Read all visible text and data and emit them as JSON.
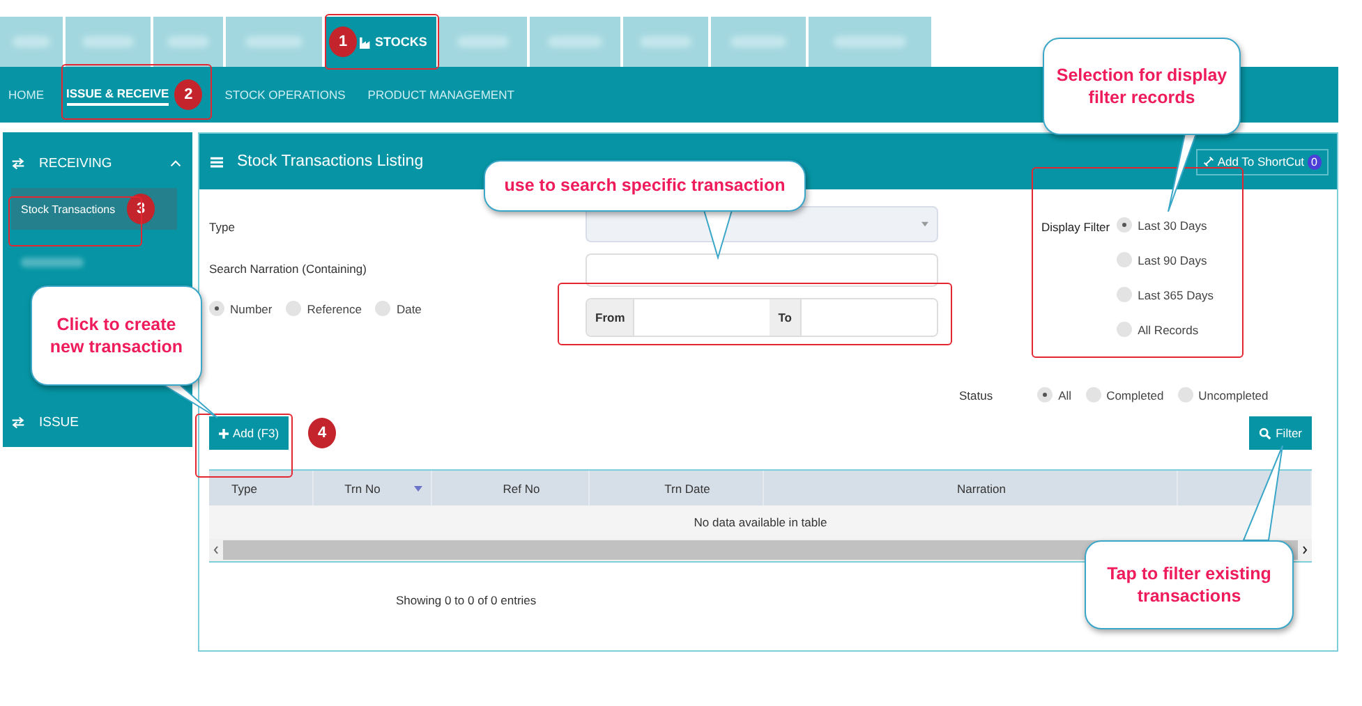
{
  "top_tabs": [
    {
      "kind": "blurred",
      "selected": false
    },
    {
      "kind": "blurred",
      "selected": false
    },
    {
      "kind": "blurred",
      "selected": false
    },
    {
      "kind": "blurred",
      "selected": false
    },
    {
      "kind": "module",
      "label": "STOCKS",
      "selected": true
    },
    {
      "kind": "blurred",
      "selected": false
    },
    {
      "kind": "blurred",
      "selected": false
    },
    {
      "kind": "blurred",
      "selected": false
    },
    {
      "kind": "blurred",
      "selected": false
    },
    {
      "kind": "blurred",
      "selected": false
    }
  ],
  "nav": [
    {
      "label": "HOME",
      "selected": false
    },
    {
      "label": "ISSUE & RECEIVE",
      "selected": true
    },
    {
      "label": "STOCK OPERATIONS",
      "selected": false
    },
    {
      "label": "PRODUCT MANAGEMENT",
      "selected": false
    }
  ],
  "sidebar": {
    "groups": [
      {
        "label": "RECEIVING",
        "expanded": true,
        "items": [
          {
            "kind": "link",
            "label": "Stock Transactions",
            "selected": true
          },
          {
            "kind": "blurred",
            "selected": false
          }
        ]
      },
      {
        "label": "ISSUE",
        "expanded": false
      }
    ]
  },
  "panel": {
    "title": "Stock Transactions Listing",
    "shortcut": {
      "label": "Add To ShortCut",
      "count": "0"
    },
    "form": {
      "type_label": "Type",
      "narration_label": "Search Narration (Containing)",
      "search_by": [
        {
          "label": "Number",
          "selected": true
        },
        {
          "label": "Reference",
          "selected": false
        },
        {
          "label": "Date",
          "selected": false
        }
      ],
      "range": {
        "from": "From",
        "to": "To"
      },
      "display_filter": {
        "label": "Display Filter",
        "options": [
          {
            "label": "Last 30 Days",
            "selected": true
          },
          {
            "label": "Last 90 Days",
            "selected": false
          },
          {
            "label": "Last 365 Days",
            "selected": false
          },
          {
            "label": "All Records",
            "selected": false
          }
        ]
      },
      "status": {
        "label": "Status",
        "options": [
          {
            "label": "All",
            "selected": true
          },
          {
            "label": "Completed",
            "selected": false
          },
          {
            "label": "Uncompleted",
            "selected": false
          }
        ]
      }
    },
    "add_button": "Add (F3)",
    "filter_button": "Filter",
    "table": {
      "columns": [
        {
          "label": "Type",
          "sorted": false
        },
        {
          "label": "Trn No",
          "sorted": true
        },
        {
          "label": "Ref No",
          "sorted": false
        },
        {
          "label": "Trn Date",
          "sorted": false
        },
        {
          "label": "Narration",
          "sorted": false
        }
      ],
      "empty_text": "No data available in table"
    },
    "footer": "Showing 0 to 0 of 0 entries"
  },
  "annotations": {
    "badges": [
      "1",
      "2",
      "3",
      "4"
    ],
    "callouts": [
      {
        "text": "Selection for display filter records"
      },
      {
        "text": "use to search specific transaction"
      },
      {
        "text": "Click to create new transaction"
      },
      {
        "text": "Tap to filter existing transactions"
      }
    ]
  }
}
